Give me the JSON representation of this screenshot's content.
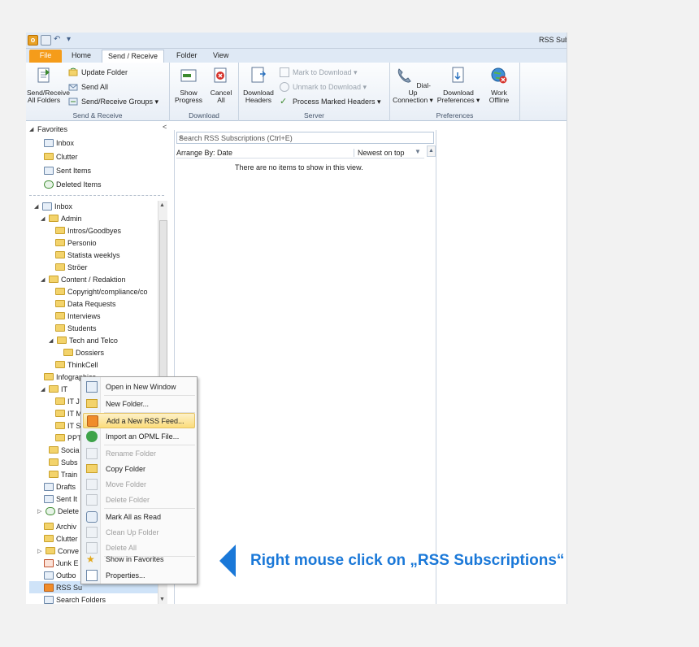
{
  "window": {
    "title": "RSS Subs"
  },
  "tabs": {
    "file": "File",
    "home": "Home",
    "send_receive": "Send / Receive",
    "folder": "Folder",
    "view": "View"
  },
  "ribbon": {
    "send_receive_group": {
      "send_receive_all_line1": "Send/Receive",
      "send_receive_all_line2": "All Folders",
      "update_folder": "Update Folder",
      "send_all": "Send All",
      "send_receive_groups": "Send/Receive Groups ▾",
      "label": "Send & Receive"
    },
    "download_group": {
      "show_progress_line1": "Show",
      "show_progress_line2": "Progress",
      "cancel_all_line1": "Cancel",
      "cancel_all_line2": "All",
      "label": "Download"
    },
    "server_group": {
      "download_headers_line1": "Download",
      "download_headers_line2": "Headers",
      "mark_to_download": "Mark to Download ▾",
      "unmark_to_download": "Unmark to Download ▾",
      "process_marked_headers": "Process Marked Headers ▾",
      "label": "Server"
    },
    "preferences_group": {
      "dialup_line1": "Dial-Up",
      "dialup_line2": "Connection ▾",
      "download_prefs_line1": "Download",
      "download_prefs_line2": "Preferences ▾",
      "work_offline_line1": "Work",
      "work_offline_line2": "Offline",
      "label": "Preferences"
    }
  },
  "nav": {
    "favorites_header": "Favorites",
    "collapse_glyph": "<",
    "favorites": [
      "Inbox",
      "Clutter",
      "Sent Items",
      "Deleted Items"
    ],
    "tree": {
      "inbox": "Inbox",
      "admin": "Admin",
      "admin_children": [
        "Intros/Goodbyes",
        "Personio",
        "Statista weeklys",
        "Ströer"
      ],
      "content": "Content / Redaktion",
      "content_children": [
        "Copyright/compliance/co",
        "Data Requests",
        "Interviews",
        "Students"
      ],
      "tech": "Tech and Telco",
      "dossiers": "Dossiers",
      "thinkcell": "ThinkCell",
      "infographics": "Infographics",
      "it": "IT",
      "it_children": [
        "IT J",
        "IT M",
        "IT S",
        "PPT"
      ],
      "socia": "Socia",
      "subs": "Subs",
      "train": "Train",
      "drafts": "Drafts",
      "sent": "Sent It",
      "deleted": "Delete",
      "archive": "Archiv",
      "clutter": "Clutter",
      "conversation": "Conve",
      "junk": "Junk E",
      "outbox": "Outbo",
      "rss": "RSS Su",
      "search_folders": "Search Folders"
    }
  },
  "list": {
    "search_placeholder": "Search RSS Subscriptions (Ctrl+E)",
    "arrange_by": "Arrange By: Date",
    "sort_order": "Newest on top",
    "sort_glyph": "▼",
    "empty_message": "There are no items to show in this view."
  },
  "context_menu": [
    {
      "label": "Open in New Window",
      "enabled": true
    },
    {
      "label": "New Folder...",
      "enabled": true
    },
    {
      "label": "Add a New RSS Feed...",
      "enabled": true,
      "highlighted": true
    },
    {
      "label": "Import an OPML File...",
      "enabled": true
    },
    {
      "label": "Rename Folder",
      "enabled": false
    },
    {
      "label": "Copy Folder",
      "enabled": true
    },
    {
      "label": "Move Folder",
      "enabled": false
    },
    {
      "label": "Delete Folder",
      "enabled": false
    },
    {
      "label": "Mark All as Read",
      "enabled": true
    },
    {
      "label": "Clean Up Folder",
      "enabled": false
    },
    {
      "label": "Delete All",
      "enabled": false
    },
    {
      "label": "Show in Favorites",
      "enabled": true
    },
    {
      "label": "Properties...",
      "enabled": true
    }
  ],
  "annotation": {
    "text": "Right mouse click on „RSS Subscriptions“",
    "color": "#1a78d8"
  },
  "colors": {
    "file_tab": "#f59c1a",
    "highlight": "#fbdc7b",
    "accent_blue": "#1a78d8"
  }
}
